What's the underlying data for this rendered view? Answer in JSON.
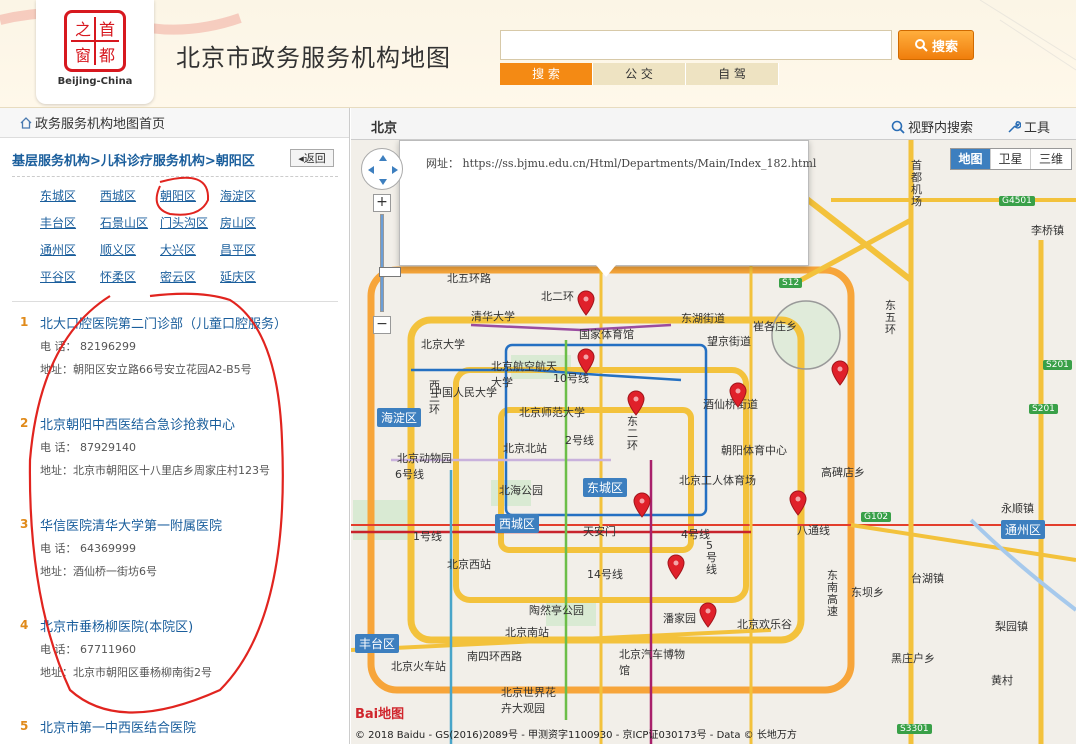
{
  "header": {
    "site_title": "北京市政务服务机构地图",
    "logo_caption": "Beijing-China",
    "logo_chars": "首都之窗",
    "search_placeholder": "",
    "search_button": "搜索",
    "modes": [
      "搜 索",
      "公 交",
      "自 驾"
    ]
  },
  "left": {
    "home_link": "政务服务机构地图首页",
    "breadcrumb": "基层服务机构>儿科诊疗服务机构>朝阳区",
    "back_button": "返回",
    "districts": [
      "东城区",
      "西城区",
      "朝阳区",
      "海淀区",
      "丰台区",
      "石景山区",
      "门头沟区",
      "房山区",
      "通州区",
      "顺义区",
      "大兴区",
      "昌平区",
      "平谷区",
      "怀柔区",
      "密云区",
      "延庆区"
    ],
    "results": [
      {
        "num": "1",
        "name": "北大口腔医院第二门诊部（儿童口腔服务）",
        "tel": "电  话： 82196299",
        "addr": "地址：朝阳区安立路66号安立花园A2-B5号"
      },
      {
        "num": "2",
        "name": "北京朝阳中西医结合急诊抢救中心",
        "tel": "电  话： 87929140",
        "addr": "地址：北京市朝阳区十八里店乡周家庄村123号"
      },
      {
        "num": "3",
        "name": "华信医院清华大学第一附属医院",
        "tel": "电  话： 64369999",
        "addr": "地址：酒仙桥一街坊6号"
      },
      {
        "num": "4",
        "name": "北京市垂杨柳医院(本院区)",
        "tel": "电  话： 67711960",
        "addr": "地址：北京市朝阳区垂杨柳南街2号"
      },
      {
        "num": "5",
        "name": "北京市第一中西医结合医院",
        "tel": "",
        "addr": ""
      }
    ]
  },
  "map": {
    "city": "北京",
    "search_in_view": "视野内搜索",
    "tools": "工具",
    "types": [
      "地图",
      "卫星",
      "三维"
    ],
    "popup_url": "网址： https://ss.bjmu.edu.cn/Html/Departments/Main/Index_182.html",
    "baidu_logo": "Bai地图",
    "copyright": "© 2018 Baidu - GS(2016)2089号 - 甲测资字1100930 - 京ICP证030173号 - Data © 长地万方",
    "district_badges": [
      "海淀区",
      "东城区",
      "西城区",
      "丰台区",
      "通州区"
    ],
    "labels": [
      "北五环路",
      "清华大学",
      "国家体育馆",
      "东湖街道",
      "望京街道",
      "北京大学",
      "北京航空航天大学",
      "中国人民大学",
      "北京师范大学",
      "北京北站",
      "北京动物园",
      "朝阳体育中心",
      "北京工人体育场",
      "北海公园",
      "天安门",
      "北京西站",
      "北京南站",
      "陶然亭公园",
      "北京火车站",
      "北京欢乐谷",
      "东坝乡",
      "南四环西路",
      "黄村",
      "永顺镇",
      "梨园镇",
      "东南高速",
      "黑庄户乡",
      "台湖镇",
      "首都机场",
      "李桥镇",
      "崔各庄乡",
      "酒仙桥街道",
      "10号线",
      "2号线",
      "1号线",
      "八通线",
      "4号线",
      "5号线",
      "6号线",
      "14号线",
      "东五环",
      "西三环",
      "北二环",
      "东二环",
      "潘家园",
      "高碑店乡",
      "北京世界花卉大观园",
      "北京汽车博物馆"
    ],
    "road_badges": [
      "S12",
      "G4501",
      "S201",
      "S201",
      "G102",
      "S3301"
    ]
  }
}
